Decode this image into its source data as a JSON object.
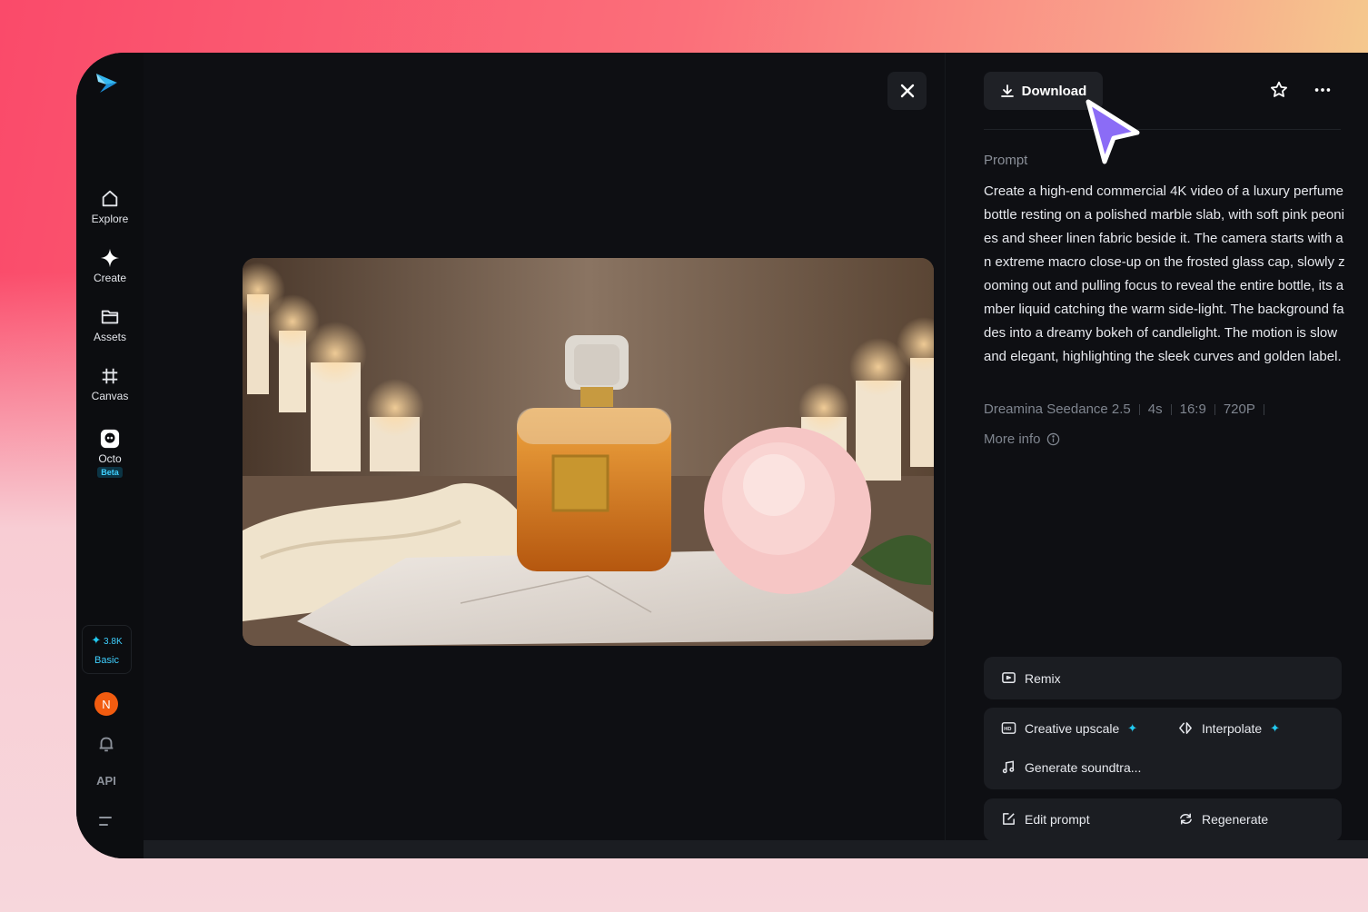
{
  "sidebar": {
    "items": [
      {
        "label": "Explore",
        "icon": "home-icon"
      },
      {
        "label": "Create",
        "icon": "sparkle-icon"
      },
      {
        "label": "Assets",
        "icon": "folder-icon"
      },
      {
        "label": "Canvas",
        "icon": "canvas-icon"
      },
      {
        "label": "Octo",
        "icon": "octo-icon",
        "badge": "Beta"
      }
    ],
    "credits": {
      "amount": "3.8K",
      "tier": "Basic"
    },
    "avatar_initial": "N",
    "api_label": "API"
  },
  "toolbar": {
    "download_label": "Download"
  },
  "prompt": {
    "label": "Prompt",
    "text": "Create a high-end commercial 4K video of a luxury perfume bottle resting on a polished marble slab, with soft pink peonies and sheer linen fabric beside it. The camera starts with an extreme macro close-up on the frosted glass cap, slowly zooming out and pulling focus to reveal the entire bottle, its amber liquid catching the warm side-light. The background fades into a dreamy bokeh of candlelight. The motion is slow and elegant, highlighting the sleek curves and golden label.",
    "meta": [
      "Dreamina Seedance 2.5",
      "4s",
      "16:9",
      "720P"
    ],
    "more_info": "More info"
  },
  "actions": {
    "remix": "Remix",
    "creative_upscale": "Creative upscale",
    "interpolate": "Interpolate",
    "generate_soundtrack": "Generate soundtra...",
    "edit_prompt": "Edit prompt",
    "regenerate": "Regenerate"
  },
  "colors": {
    "accent": "#3fd0ff",
    "avatar": "#f25c10",
    "cursor": "#8b6cf6"
  }
}
